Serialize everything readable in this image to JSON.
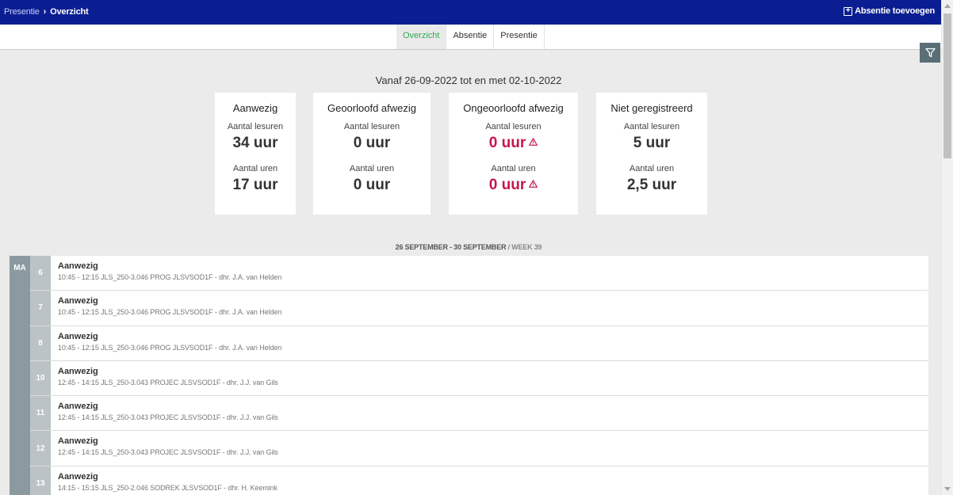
{
  "header": {
    "breadcrumb_parent": "Presentie",
    "breadcrumb_current": "Overzicht",
    "add_absence_label": "Absentie toevoegen"
  },
  "tabs": [
    {
      "label": "Overzicht",
      "active": true
    },
    {
      "label": "Absentie",
      "active": false
    },
    {
      "label": "Presentie",
      "active": false
    }
  ],
  "summary": {
    "period": "Vanaf 26-09-2022 tot en met 02-10-2022",
    "cards": [
      {
        "title": "Aanwezig",
        "lessons_label": "Aantal lesuren",
        "lessons_value": "34 uur",
        "hours_label": "Aantal uren",
        "hours_value": "17 uur",
        "warning": false
      },
      {
        "title": "Geoorloofd afwezig",
        "lessons_label": "Aantal lesuren",
        "lessons_value": "0 uur",
        "hours_label": "Aantal uren",
        "hours_value": "0 uur",
        "warning": false
      },
      {
        "title": "Ongeoorloofd afwezig",
        "lessons_label": "Aantal lesuren",
        "lessons_value": "0 uur",
        "hours_label": "Aantal uren",
        "hours_value": "0 uur",
        "warning": true
      },
      {
        "title": "Niet geregistreerd",
        "lessons_label": "Aantal lesuren",
        "lessons_value": "5 uur",
        "hours_label": "Aantal uren",
        "hours_value": "2,5 uur",
        "warning": false
      }
    ]
  },
  "week": {
    "range": "26 SEPTEMBER - 30 SEPTEMBER",
    "week_label": "/ WEEK 39",
    "day": "MA",
    "rows": [
      {
        "hour": "6",
        "status": "Aanwezig",
        "detail": "10:45 - 12:15 JLS_250-3.046 PROG JLSVSOD1F - dhr. J.A. van Helden"
      },
      {
        "hour": "7",
        "status": "Aanwezig",
        "detail": "10:45 - 12:15 JLS_250-3.046 PROG JLSVSOD1F - dhr. J.A. van Helden"
      },
      {
        "hour": "8",
        "status": "Aanwezig",
        "detail": "10:45 - 12:15 JLS_250-3.046 PROG JLSVSOD1F - dhr. J.A. van Helden"
      },
      {
        "hour": "10",
        "status": "Aanwezig",
        "detail": "12:45 - 14:15 JLS_250-3.043 PROJEC JLSVSOD1F - dhr. J.J. van Gils"
      },
      {
        "hour": "11",
        "status": "Aanwezig",
        "detail": "12:45 - 14:15 JLS_250-3.043 PROJEC JLSVSOD1F - dhr. J.J. van Gils"
      },
      {
        "hour": "12",
        "status": "Aanwezig",
        "detail": "12:45 - 14:15 JLS_250-3.043 PROJEC JLSVSOD1F - dhr. J.J. van Gils"
      },
      {
        "hour": "13",
        "status": "Aanwezig",
        "detail": "14:15 - 15:15 JLS_250-2.046 SODREK JLSVSOD1F - dhr. H. Keemink"
      }
    ]
  },
  "colors": {
    "topbar": "#0b1e91",
    "active_tab": "#2ea84f",
    "warning": "#c8154a"
  }
}
